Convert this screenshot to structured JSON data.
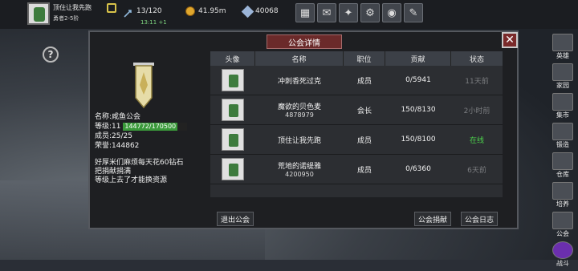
{
  "player": {
    "name": "顶住让我先跑",
    "rank": "勇者2-5阶"
  },
  "stats": {
    "energy": "13/120",
    "energy_timer": "13:11 +1",
    "gold": "41.95m",
    "gems": "40068"
  },
  "sidebar": [
    {
      "label": "英雄"
    },
    {
      "label": "家园"
    },
    {
      "label": "集市"
    },
    {
      "label": "锻造"
    },
    {
      "label": "仓库"
    },
    {
      "label": "培养"
    },
    {
      "label": "公会"
    },
    {
      "label": "战斗"
    }
  ],
  "dialog": {
    "title": "公会详情",
    "close": "✕",
    "columns": [
      "头像",
      "名称",
      "职位",
      "贡献",
      "状态"
    ],
    "members": [
      {
        "name": "冲刺香死过克",
        "id": "",
        "role": "成员",
        "contrib": "0/5941",
        "status": "11天前",
        "online": false
      },
      {
        "name": "魔欲的贝色麦",
        "id": "4878979",
        "role": "会长",
        "contrib": "150/8130",
        "status": "2小时前",
        "online": false
      },
      {
        "name": "顶住让我先跑",
        "id": "",
        "role": "成员",
        "contrib": "150/8100",
        "status": "在线",
        "online": true
      },
      {
        "name": "荒地的诺缇雅",
        "id": "4200950",
        "role": "成员",
        "contrib": "0/6360",
        "status": "6天前",
        "online": false
      },
      {
        "name": "",
        "id": "",
        "role": "",
        "contrib": "",
        "status": "",
        "online": false
      }
    ],
    "guild": {
      "name_label": "名称:",
      "name": "咸鱼公会",
      "level_label": "等级:",
      "level": "11",
      "exp": "144772/170500",
      "exp_fraction": 0.849,
      "members_label": "成员:",
      "members": "25/25",
      "honor_label": "荣誉:",
      "honor": "144862"
    },
    "notice": [
      "好厚米们麻烦每天花60钻石",
      "把捐献捐满",
      "等级上去了才能换资源"
    ],
    "buttons": {
      "quit": "退出公会",
      "donate": "公会捐献",
      "log": "公会日志"
    }
  },
  "colors": {
    "online": "#4cd44c",
    "offline": "#7b7d80",
    "title_bg": "#6b2a2a",
    "exp_fill": "#3a9a3a"
  }
}
